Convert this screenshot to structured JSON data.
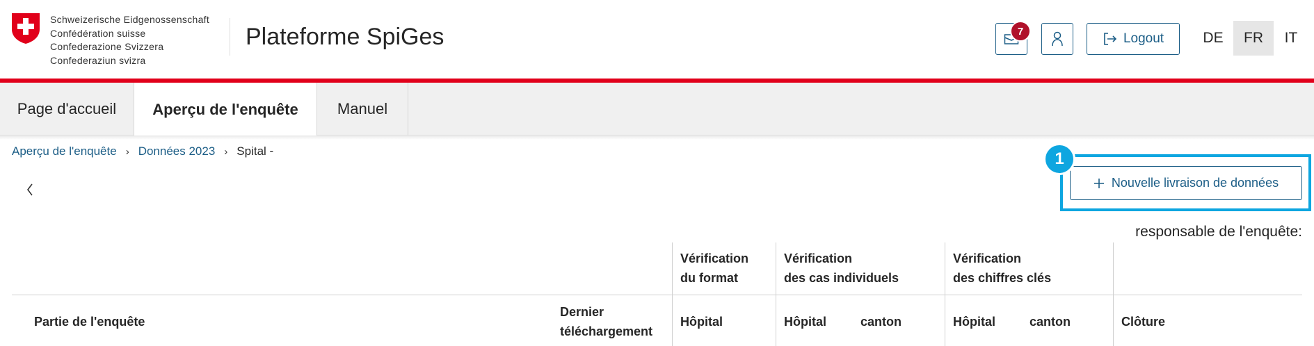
{
  "header": {
    "confederation_lines": [
      "Schweizerische Eidgenossenschaft",
      "Confédération suisse",
      "Confederazione Svizzera",
      "Confederaziun svizra"
    ],
    "app_title": "Plateforme SpiGes",
    "messages_badge": "7",
    "logout_label": "Logout",
    "languages": [
      "DE",
      "FR",
      "IT"
    ],
    "active_language": "FR"
  },
  "nav": {
    "tabs": [
      "Page d'accueil",
      "Aperçu de l'enquête",
      "Manuel"
    ],
    "active_tab": "Aperçu de l'enquête"
  },
  "breadcrumb": {
    "items": [
      "Aperçu de l'enquête",
      "Données 2023",
      "Spital -"
    ]
  },
  "actions": {
    "new_delivery_label": "Nouvelle livraison de données",
    "step_number": "1"
  },
  "responsible_label": "responsable de l'enquête:",
  "table": {
    "group_headers": {
      "format": [
        "Vérification",
        "du format"
      ],
      "cases": [
        "Vérification",
        "des cas individuels"
      ],
      "figures": [
        "Vérification",
        "des chiffres clés"
      ]
    },
    "columns": {
      "part": "Partie de l'enquête",
      "last_upload": [
        "Dernier",
        "téléchargement"
      ],
      "hospital_format": "Hôpital",
      "hospital_cases": "Hôpital",
      "canton_cases": "canton",
      "hospital_figures": "Hôpital",
      "canton_figures": "canton",
      "closure": "Clôture"
    }
  },
  "colors": {
    "swiss_red": "#e1001a",
    "link_blue": "#1b5d86",
    "highlight_blue": "#0ea6e0",
    "badge_red": "#b0112a"
  },
  "icons": {
    "messages": "mail-icon",
    "profile": "user-icon",
    "logout": "logout-icon",
    "add": "plus-icon",
    "back": "chevron-left-icon"
  }
}
